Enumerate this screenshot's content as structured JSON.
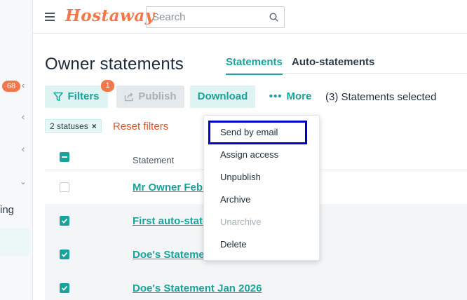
{
  "app": {
    "logo": "Hostaway"
  },
  "search": {
    "placeholder": "Search"
  },
  "sidebar": {
    "badge": "68",
    "partial_label": "ing"
  },
  "page": {
    "title": "Owner statements",
    "tabs": [
      {
        "label": "Statements",
        "active": true
      },
      {
        "label": "Auto-statements",
        "active": false
      }
    ]
  },
  "toolbar": {
    "filters_label": "Filters",
    "filters_count": "1",
    "publish_label": "Publish",
    "download_label": "Download",
    "more_label": "More",
    "selection_text": "(3) Statements selected"
  },
  "filters": {
    "chip_label": "2 statuses",
    "chip_remove": "×",
    "reset_label": "Reset filters"
  },
  "table": {
    "column_header": "Statement",
    "rows": [
      {
        "name": "Mr Owner Febr",
        "checked": false
      },
      {
        "name": "First auto-state",
        "checked": true
      },
      {
        "name": "Doe's Statement",
        "checked": true
      },
      {
        "name": "Doe's Statement Jan 2026",
        "checked": true
      }
    ]
  },
  "more_menu": {
    "items": [
      {
        "label": "Send by email",
        "enabled": true
      },
      {
        "label": "Assign access",
        "enabled": true
      },
      {
        "label": "Unpublish",
        "enabled": true
      },
      {
        "label": "Archive",
        "enabled": true
      },
      {
        "label": "Unarchive",
        "enabled": false
      },
      {
        "label": "Delete",
        "enabled": true
      }
    ]
  },
  "colors": {
    "accent": "#1aa39c",
    "brand": "#f2784b",
    "danger": "#d9542b",
    "highlight": "#0000cc"
  }
}
